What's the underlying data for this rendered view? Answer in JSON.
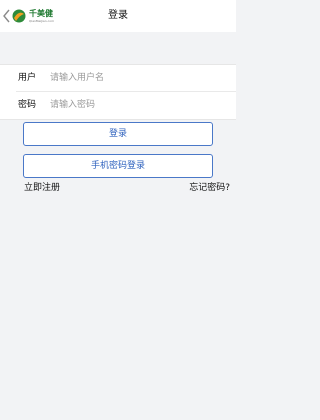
{
  "header": {
    "title": "登录",
    "logo_brand": "千美健",
    "logo_sub": "QianMeiJian.com",
    "back_icon": "chevron-left-icon"
  },
  "form": {
    "username_label": "用户",
    "username_placeholder": "请输入用户名",
    "username_value": "",
    "password_label": "密码",
    "password_placeholder": "请输入密码",
    "password_value": ""
  },
  "actions": {
    "login_label": "登录",
    "phone_login_label": "手机密码登录",
    "register_label": "立即注册",
    "forgot_label": "忘记密码?"
  },
  "colors": {
    "accent": "#4a78c8",
    "brand_green": "#1f7a31",
    "background": "#f2f3f5"
  }
}
